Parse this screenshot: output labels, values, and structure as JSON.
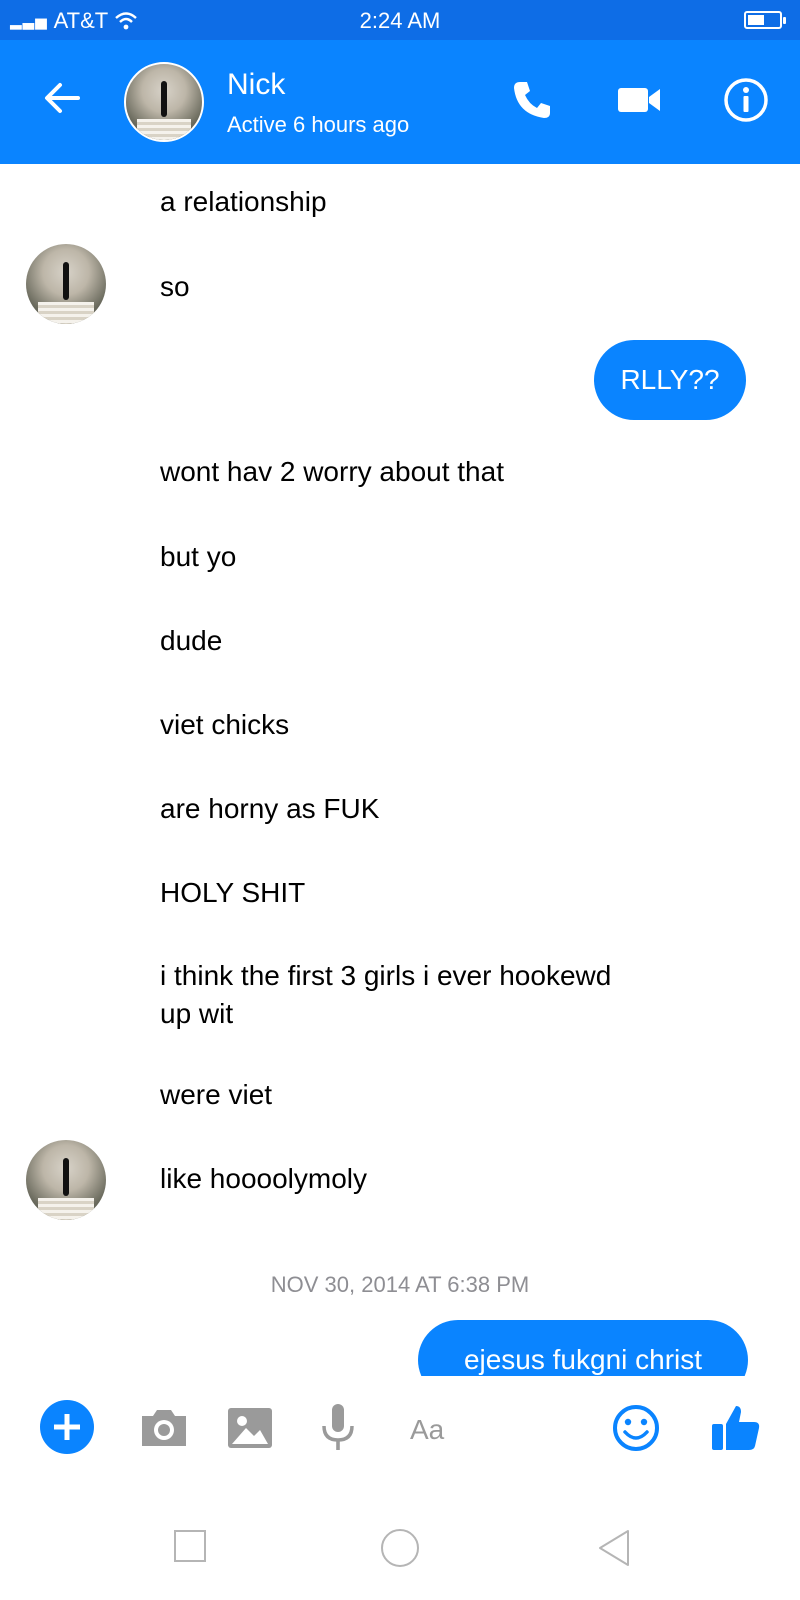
{
  "status_bar": {
    "carrier": "AT&T",
    "time": "2:24 AM"
  },
  "header": {
    "name": "Nick",
    "status": "Active 6 hours ago"
  },
  "messages": {
    "m1": "a relationship",
    "m2": "so",
    "m3": "RLLY??",
    "m4": "wont hav 2 worry about that",
    "m5": "but yo",
    "m6": "dude",
    "m7": "viet chicks",
    "m8": "are horny as FUK",
    "m9": "HOLY SHIT",
    "m10_line1": "i think the first 3 girls i ever hookewd",
    "m10_line2": "up wit",
    "m11": "were viet",
    "m12": "like hoooolymoly",
    "m13": "ejesus fukgni christ"
  },
  "timestamp": "NOV 30, 2014 AT 6:38 PM",
  "composer": {
    "placeholder": "Aa"
  },
  "colors": {
    "accent": "#0a84ff",
    "status_bar": "#0e6de6",
    "timestamp": "#8e8e93"
  },
  "icons": [
    "back-arrow-icon",
    "phone-icon",
    "video-camera-icon",
    "info-icon",
    "plus-icon",
    "camera-icon",
    "image-icon",
    "microphone-icon",
    "emoji-icon",
    "thumbs-up-icon",
    "nav-square-icon",
    "nav-circle-icon",
    "nav-triangle-icon"
  ]
}
